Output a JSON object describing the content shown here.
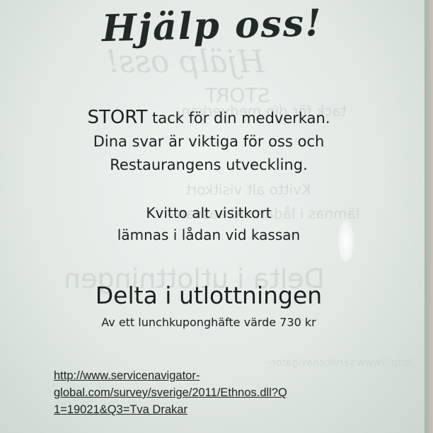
{
  "sign": {
    "title": "Hjälp oss!",
    "thanks": {
      "emphasis": "STORT",
      "line1_rest": " tack för din medverkan.",
      "line2": "Dina svar är viktiga för oss och",
      "line3": "Restaurangens utveckling."
    },
    "receipt": {
      "line1": "Kvitto alt visitkort",
      "line2": "lämnas i lådan vid kassan"
    },
    "lottery": {
      "heading": "Delta i utlottningen",
      "prize": "Av ett lunchkuponghäfte värde 730 kr"
    },
    "link": {
      "line1": "http://www.servicenavigator-",
      "line2": "global.com/survey/sverige/2011/Ethnos.dll?Q",
      "line3": "1=19021&Q3=Tva Drakar"
    }
  },
  "colors": {
    "paper": "#e6ece9",
    "ink": "#1a211e",
    "backdrop": "#bfc8c3"
  }
}
